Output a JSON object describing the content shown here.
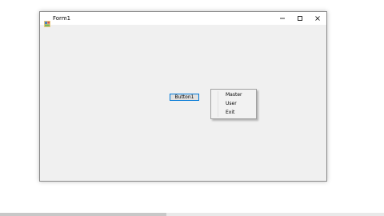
{
  "window": {
    "title": "Form1",
    "icon": "form-app-icon",
    "controls": [
      "minimize-icon",
      "maximize-icon",
      "close-icon"
    ]
  },
  "form": {
    "button_label": "Button1"
  },
  "context_menu": {
    "items": [
      {
        "label": "Master"
      },
      {
        "label": "User"
      },
      {
        "label": "Exit"
      }
    ]
  },
  "colors": {
    "accent": "#0078d7",
    "form_background": "#f0f0f0"
  }
}
